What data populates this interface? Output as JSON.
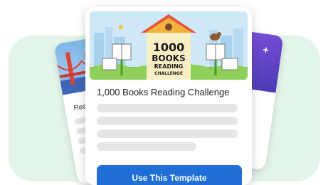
{
  "back_card_left": {
    "label": "Rea"
  },
  "back_card_right": {
    "icon": "plus-icon"
  },
  "main_card": {
    "banner": {
      "number": "1000",
      "line1": "BOOKS",
      "line2": "READING",
      "line3": "CHALLENGE"
    },
    "title": "1,000 Books Reading Challenge",
    "cta_label": "Use This Template"
  },
  "colors": {
    "accent": "#1f6fd6",
    "background_blob": "#e3f5ea",
    "placeholder": "#e5e5e5"
  }
}
